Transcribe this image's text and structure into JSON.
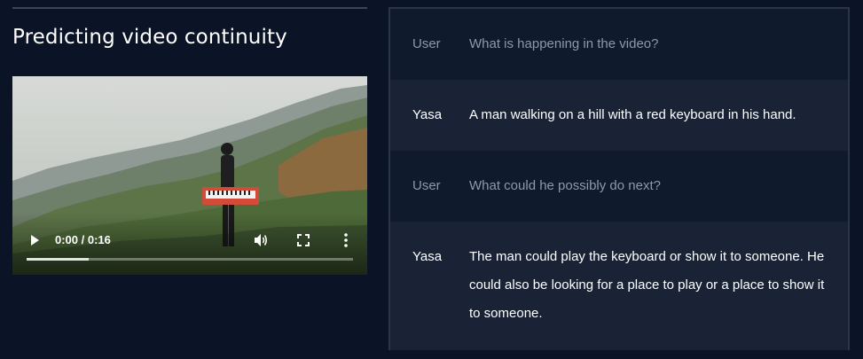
{
  "section": {
    "title": "Predicting video continuity"
  },
  "video": {
    "time": "0:00 / 0:16",
    "progress_fraction": 0.19,
    "icons": {
      "play": "play-icon",
      "volume": "volume-icon",
      "fullscreen": "fullscreen-icon",
      "more": "more-vertical-icon"
    }
  },
  "chat": {
    "messages": [
      {
        "speaker": "User",
        "text": "What is happening in the video?"
      },
      {
        "speaker": "Yasa",
        "text": "A man walking on a hill with a red keyboard in his hand."
      },
      {
        "speaker": "User",
        "text": "What could he possibly do next?"
      },
      {
        "speaker": "Yasa",
        "text": "The man could play the keyboard or show it to someone. He could also be looking for a place to play or a place to show it to someone."
      }
    ]
  },
  "colors": {
    "background": "#0b1426",
    "panel_border": "#2a3546",
    "user_row": "#0f1a2d",
    "model_row": "#192335",
    "user_text": "#8f98a6",
    "model_text": "#ffffff"
  }
}
